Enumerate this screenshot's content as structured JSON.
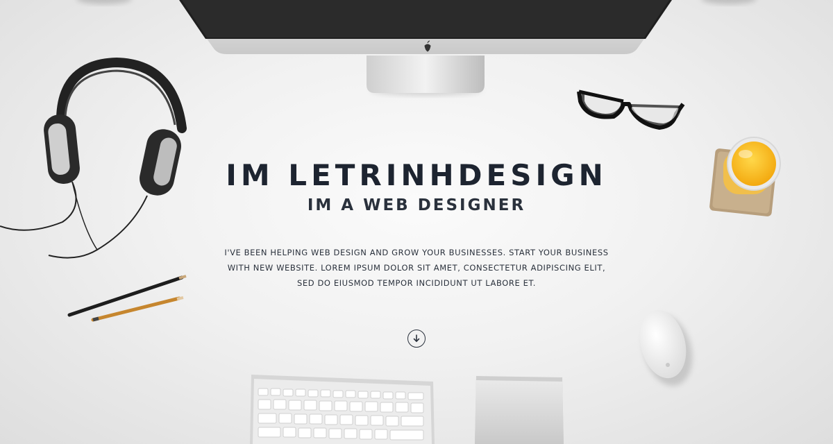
{
  "hero": {
    "title": "IM LETRINHDESIGN",
    "subtitle": "IM A WEB DESIGNER",
    "description_lines": [
      "I'VE BEEN HELPING WEB DESIGN AND GROW YOUR BUSINESSES. START YOUR BUSINESS",
      "WITH NEW WEBSITE. LOREM IPSUM DOLOR SIT AMET, CONSECTETUR ADIPISCING ELIT,",
      "SED DO EIUSMOD TEMPOR INCIDIDUNT UT LABORE ET."
    ]
  },
  "scroll_button": {
    "icon": "arrow-down-circle-icon"
  },
  "colors": {
    "text_dark": "#1d2430",
    "background": "#f1f1f1",
    "juice": "#f7b81e"
  }
}
